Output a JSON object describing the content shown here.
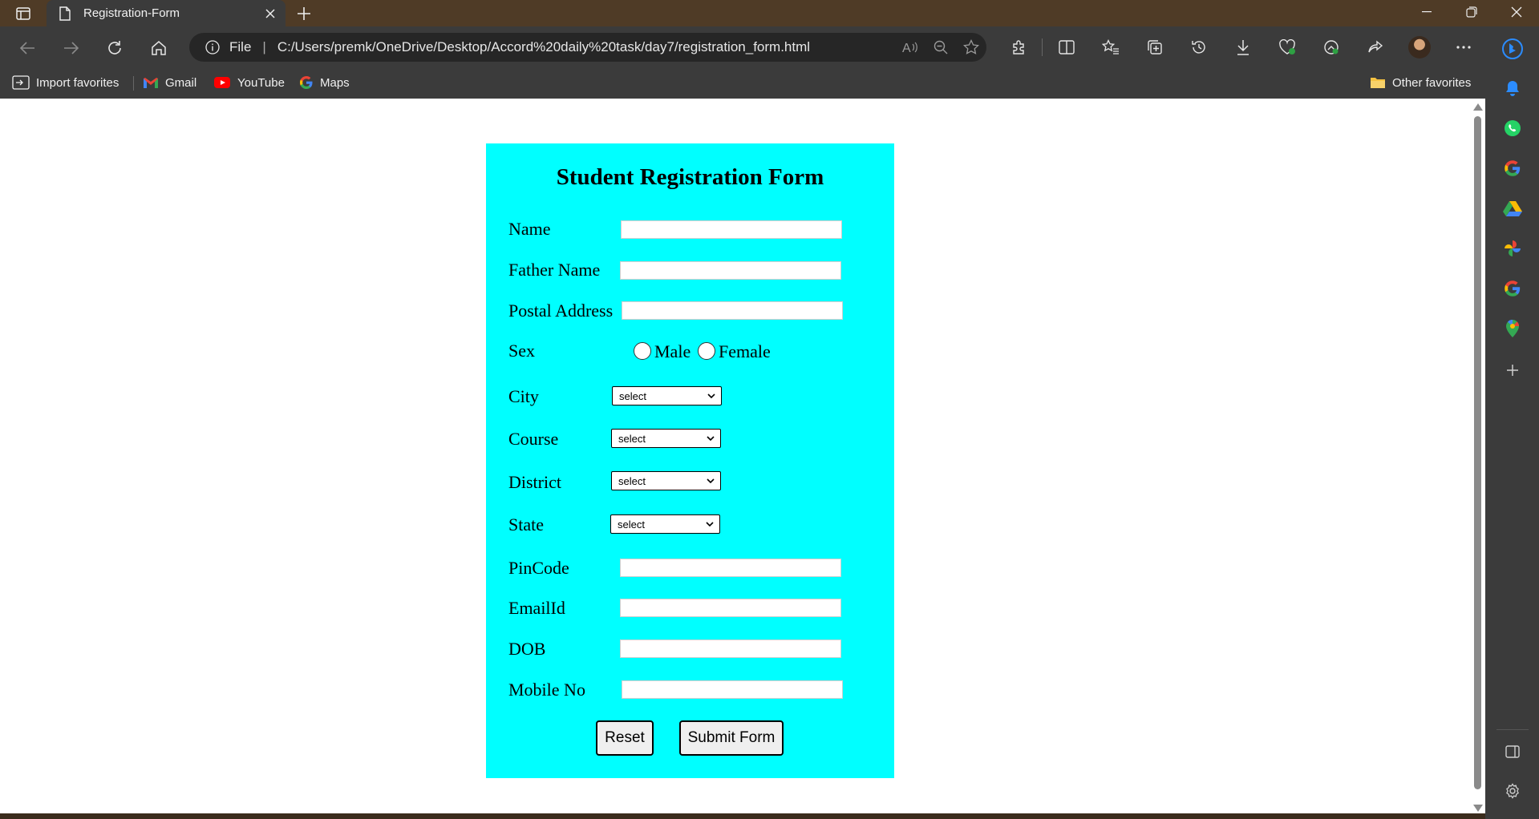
{
  "browser": {
    "tab_title": "Registration-Form",
    "address": {
      "scheme_label": "File",
      "url": "C:/Users/premk/OneDrive/Desktop/Accord%20daily%20task/day7/registration_form.html"
    },
    "favorites": {
      "import": "Import favorites",
      "gmail": "Gmail",
      "youtube": "YouTube",
      "maps": "Maps",
      "other": "Other favorites"
    }
  },
  "form": {
    "title": "Student Registration Form",
    "labels": {
      "name": "Name",
      "father_name": "Father Name",
      "postal_address": "Postal Address",
      "sex": "Sex",
      "city": "City",
      "course": "Course",
      "district": "District",
      "state": "State",
      "pincode": "PinCode",
      "email": "EmailId",
      "dob": "DOB",
      "mobile": "Mobile No"
    },
    "sex_options": {
      "male": "Male",
      "female": "Female"
    },
    "selects": {
      "city": "select",
      "course": "select",
      "district": "select",
      "state": "select"
    },
    "buttons": {
      "reset": "Reset",
      "submit": "Submit Form"
    }
  },
  "colors": {
    "form_background": "#00ffff",
    "browser_chrome": "#3b3b3b",
    "title_bar": "#4f3b26"
  }
}
